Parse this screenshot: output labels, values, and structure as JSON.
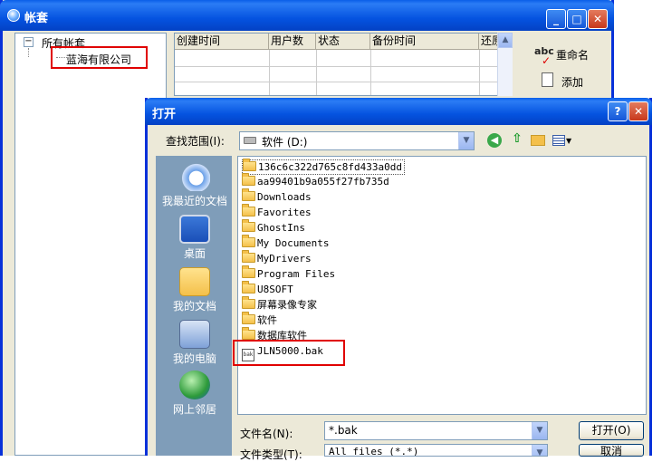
{
  "back_window": {
    "title": "帐套",
    "tree": {
      "root": "所有帐套",
      "child": "蓝海有限公司"
    },
    "grid_columns": [
      "创建时间",
      "用户数",
      "状态",
      "备份时间",
      "还原"
    ],
    "buttons": {
      "rename": "重命名",
      "add": "添加"
    }
  },
  "dialog": {
    "title": "打开",
    "lookin_label": "查找范围(I):",
    "lookin_value": "软件 (D:)",
    "places": [
      "我最近的文档",
      "桌面",
      "我的文档",
      "我的电脑",
      "网上邻居"
    ],
    "files": [
      {
        "name": "136c6c322d765c8fd433a0dd",
        "type": "folder"
      },
      {
        "name": "aa99401b9a055f27fb735d",
        "type": "folder"
      },
      {
        "name": "Downloads",
        "type": "folder"
      },
      {
        "name": "Favorites",
        "type": "folder"
      },
      {
        "name": "GhostIns",
        "type": "folder"
      },
      {
        "name": "My Documents",
        "type": "folder"
      },
      {
        "name": "MyDrivers",
        "type": "folder"
      },
      {
        "name": "Program Files",
        "type": "folder"
      },
      {
        "name": "U8SOFT",
        "type": "folder"
      },
      {
        "name": "屏幕录像专家",
        "type": "folder"
      },
      {
        "name": "软件",
        "type": "folder"
      },
      {
        "name": "数据库软件",
        "type": "folder"
      },
      {
        "name": "JLN5000.bak",
        "type": "file"
      }
    ],
    "filename_label": "文件名(N):",
    "filename_value": "*.bak",
    "filetype_label": "文件类型(T):",
    "filetype_value": "All files (*.*)",
    "open_button": "打开(O)",
    "cancel_button": "取消"
  },
  "colors": {
    "title_blue": "#0553e0",
    "highlight_red": "#e00000",
    "places_bg": "#7f9db9"
  }
}
